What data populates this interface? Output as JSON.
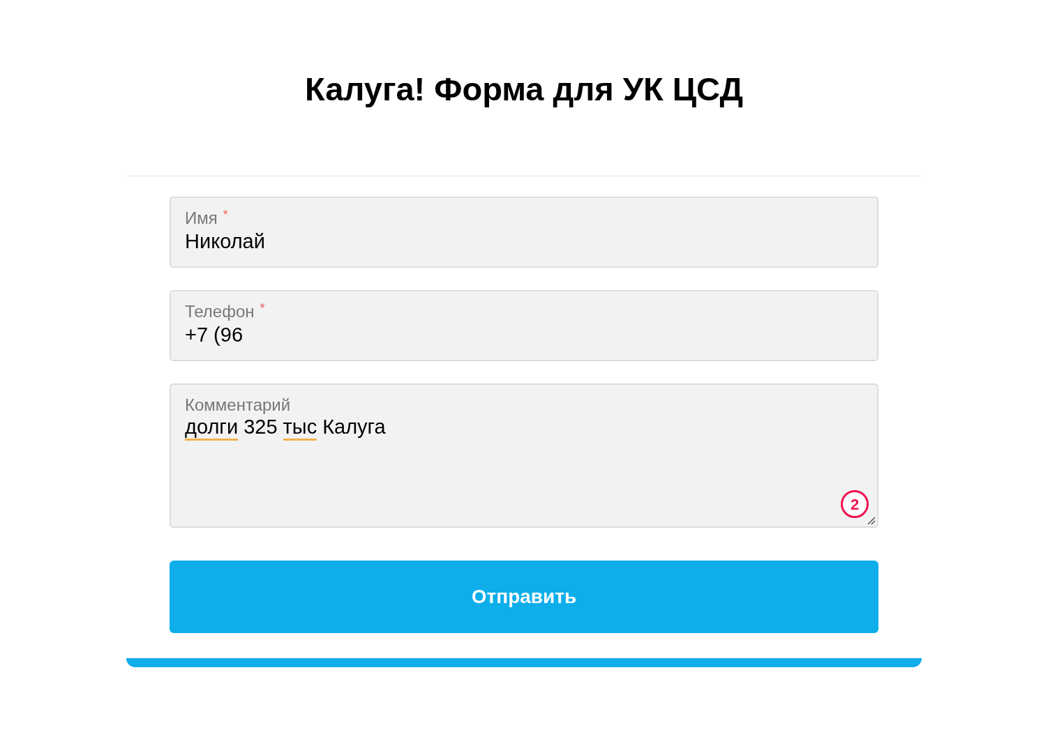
{
  "form": {
    "title": "Калуга! Форма для УК ЦСД",
    "required_mark": "*",
    "fields": [
      {
        "kind": "input",
        "label": "Имя",
        "required": true,
        "value": "Николай"
      },
      {
        "kind": "input",
        "label": "Телефон",
        "required": true,
        "value": "+7 (96"
      },
      {
        "kind": "textarea",
        "label": "Комментарий",
        "required": false,
        "words": [
          {
            "text": "долги",
            "flagged": true
          },
          {
            "text": "325",
            "flagged": false
          },
          {
            "text": "тыс",
            "flagged": true
          },
          {
            "text": "Калуга",
            "flagged": false
          }
        ],
        "badge": "2"
      }
    ],
    "submit": "Отправить"
  }
}
